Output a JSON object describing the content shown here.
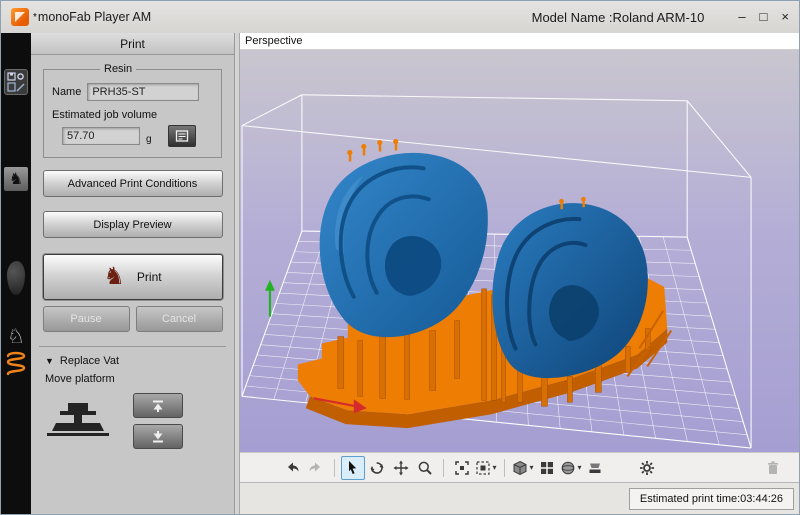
{
  "titlebar": {
    "unsaved_marker": "*",
    "app_title": "monoFab Player AM",
    "model_name": "Model Name :Roland ARM-10"
  },
  "icons": {
    "minimize_glyph": "–",
    "maximize_glyph": "□",
    "close_glyph": "×",
    "dropdown_glyph": "▾",
    "replace_vat_arrow": "▼",
    "black_knight_glyph": "♞",
    "white_knight_glyph": "♘"
  },
  "sidebar": {
    "items": [
      "file-tools",
      "placement-board",
      "model-silhouette",
      "print-job",
      "support-coil"
    ]
  },
  "print_panel": {
    "title": "Print",
    "resin_group": {
      "legend": "Resin",
      "name_label": "Name",
      "name_value": "PRH35-ST",
      "volume_label": "Estimated job volume",
      "volume_value": "57.70",
      "volume_unit": "g"
    },
    "advanced_button": "Advanced Print Conditions",
    "preview_button": "Display Preview",
    "print_button": "Print",
    "pause_button": "Pause",
    "cancel_button": "Cancel",
    "replace_vat_label": "Replace Vat",
    "move_platform_label": "Move platform"
  },
  "viewport": {
    "view_mode": "Perspective"
  },
  "toolbar": {
    "tools": [
      "undo",
      "redo",
      "select",
      "orbit",
      "pan",
      "zoom",
      "zoom-fit",
      "zoom-region",
      "view-cube",
      "quad-view",
      "display-mode-sphere",
      "vat-view",
      "settings",
      "delete"
    ]
  },
  "statusbar": {
    "print_time": "Estimated print time:03:44:26"
  },
  "colors": {
    "model_blue": "#1d6fb8",
    "support_orange": "#ee7d04",
    "selection_accent": "#5f9fd0",
    "scene_top": "#c9c6cf",
    "scene_bottom": "#a59ed2"
  }
}
